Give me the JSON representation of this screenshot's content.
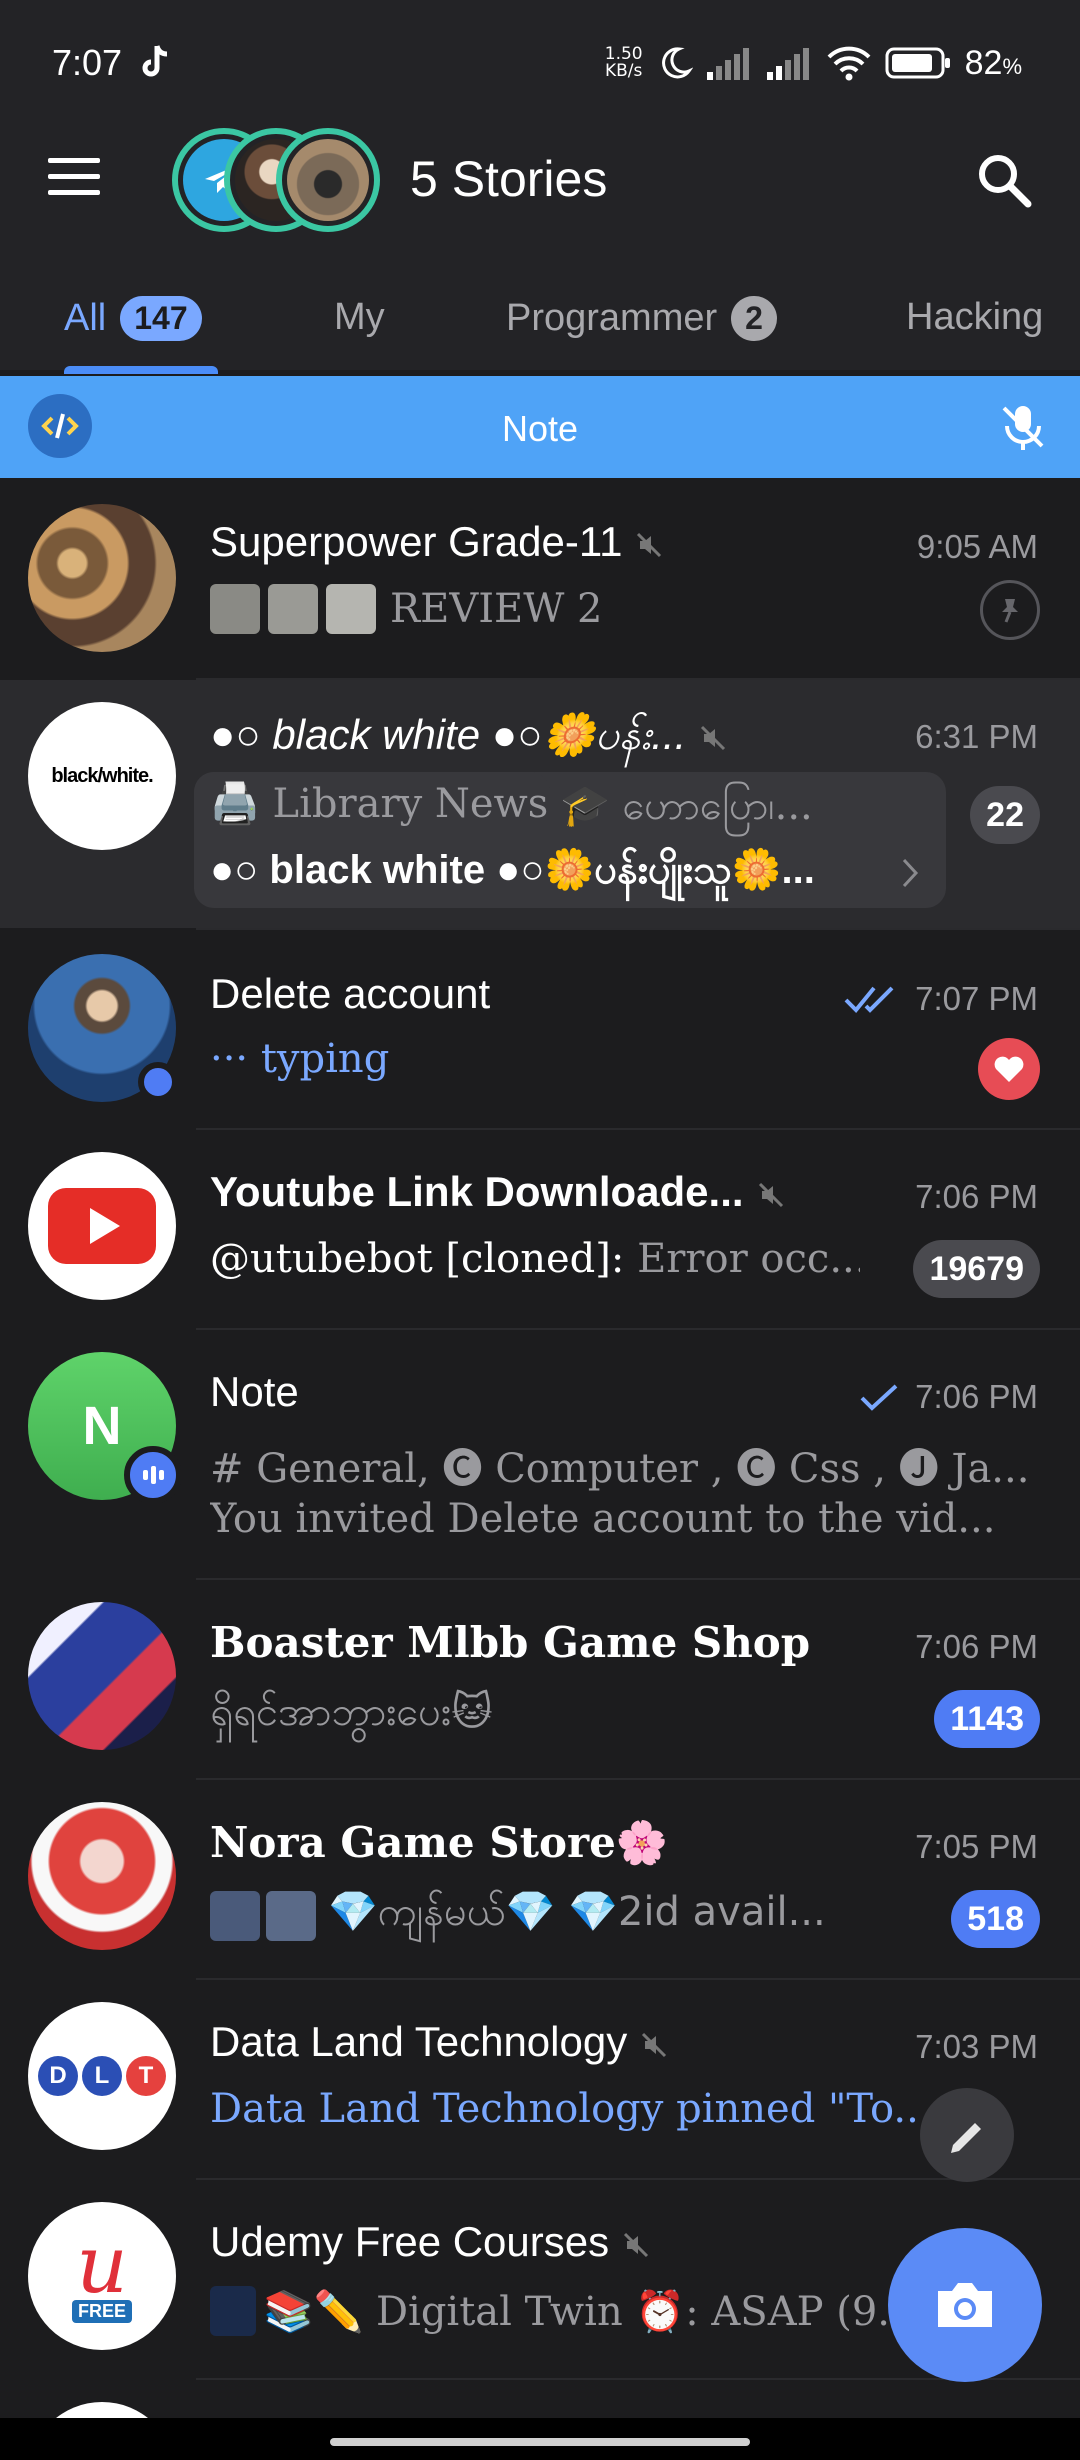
{
  "status_bar": {
    "time": "7:07",
    "net_speed_value": "1.50",
    "net_speed_unit": "KB/s",
    "battery": "82",
    "battery_unit": "%"
  },
  "header": {
    "title": "5 Stories"
  },
  "tabs": [
    {
      "label": "All",
      "badge": "147",
      "active": true
    },
    {
      "label": "My",
      "badge": ""
    },
    {
      "label": "Programmer",
      "badge": "2"
    },
    {
      "label": "Hacking",
      "badge": ""
    }
  ],
  "note_bar": {
    "title": "Note"
  },
  "chats": [
    {
      "name": "Superpower Grade-11",
      "time": "9:05 AM",
      "preview": "REVIEW 2",
      "muted": true,
      "pinned": true
    },
    {
      "name": "●○ black white ●○🌼ပန်း...",
      "time": "6:31 PM",
      "preview": "🖨️ Library News",
      "preview2": "🎓 ဟောပြော၊...",
      "preview3": "●○ black white ●○🌼ပန်းပျိုးသူ🌼...",
      "badge": "22",
      "muted": true,
      "archived": true
    },
    {
      "name": "Delete account",
      "time": "7:07 PM",
      "preview": "··· typing",
      "reaction": "heart"
    },
    {
      "name": "Youtube Link Downloade...",
      "time": "7:06 PM",
      "preview_sender": "@utubebot [cloned]:",
      "preview": " Error occ...",
      "badge": "19679",
      "muted": true
    },
    {
      "name": "Note",
      "time": "7:06 PM",
      "avatar_letter": "N",
      "preview": "# General, 🅒 Computer , 🅒 Css , 🅙 Ja...",
      "preview2": "You invited Delete account to the vid..."
    },
    {
      "name": "Boaster Mlbb Game Shop",
      "time": "7:06 PM",
      "preview": "ရှိရင်အာဘွားပေး🐱",
      "badge": "1143"
    },
    {
      "name": "Nora Game Store🌸",
      "time": "7:05 PM",
      "preview": "💎ကျန်မယ်💎 💎2id avail...",
      "badge": "518"
    },
    {
      "name": "Data Land Technology",
      "time": "7:03 PM",
      "preview": "Data Land Technology pinned \"To...",
      "muted": true
    },
    {
      "name": "Udemy Free Courses",
      "time": "",
      "preview": "📚✏️ Digital Twin ⏰: ASAP (9.",
      "muted": true
    }
  ],
  "avatars": {
    "dlt": [
      "D",
      "L",
      "T"
    ],
    "udemy": "FREE",
    "blackwhite": "black/white."
  },
  "colors": {
    "accent": "#4f7cf4",
    "note_bar": "#4fa3f7",
    "story_ring": "#3bc7a3"
  }
}
